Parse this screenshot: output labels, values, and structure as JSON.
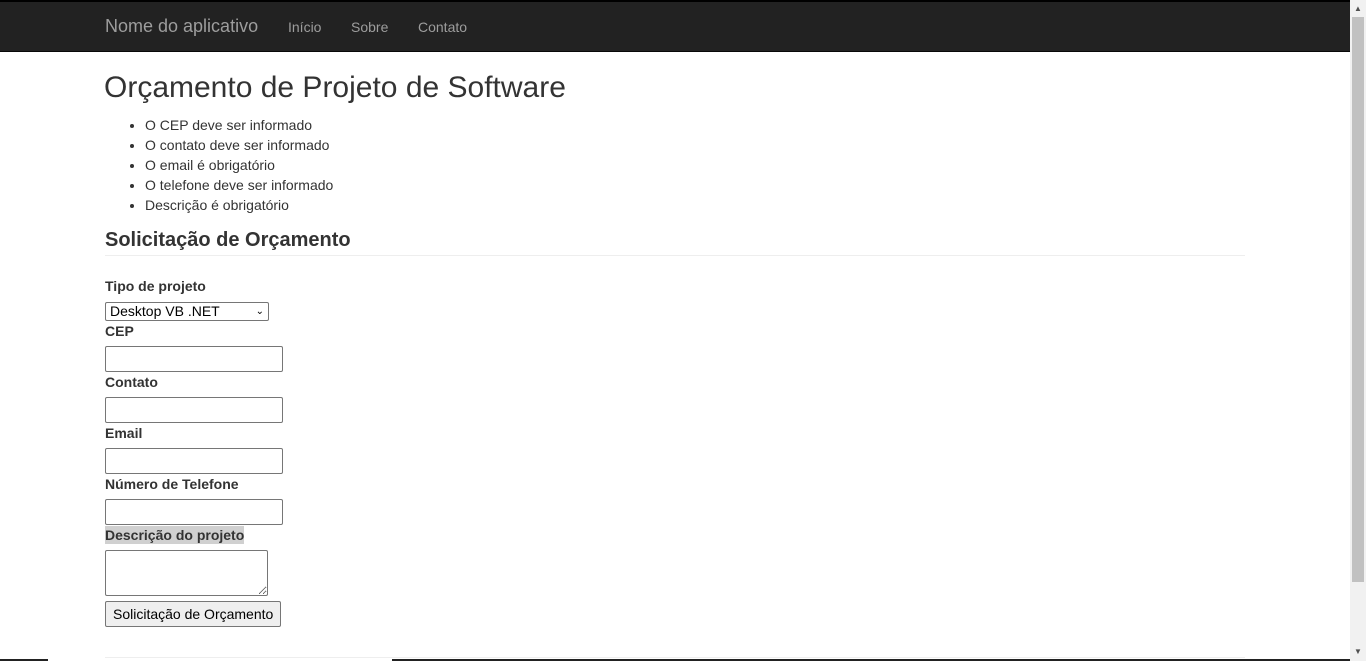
{
  "navbar": {
    "brand": "Nome do aplicativo",
    "links": [
      "Início",
      "Sobre",
      "Contato"
    ]
  },
  "page": {
    "title": "Orçamento de Projeto de Software",
    "errors": [
      "O CEP deve ser informado",
      "O contato deve ser informado",
      "O email é obrigatório",
      "O telefone deve ser informado",
      "Descrição é obrigatório"
    ],
    "section_title": "Solicitação de Orçamento"
  },
  "form": {
    "tipo_label": "Tipo de projeto",
    "tipo_value": "Desktop VB .NET",
    "cep_label": "CEP",
    "cep_value": "",
    "contato_label": "Contato",
    "contato_value": "",
    "email_label": "Email",
    "email_value": "",
    "telefone_label": "Número de Telefone",
    "telefone_value": "",
    "descricao_label": "Descrição do projeto",
    "descricao_value": "",
    "submit_label": "Solicitação de Orçamento"
  },
  "colors": {
    "navbar_bg": "#222222",
    "nav_text": "#9d9d9d",
    "body_text": "#333333"
  }
}
